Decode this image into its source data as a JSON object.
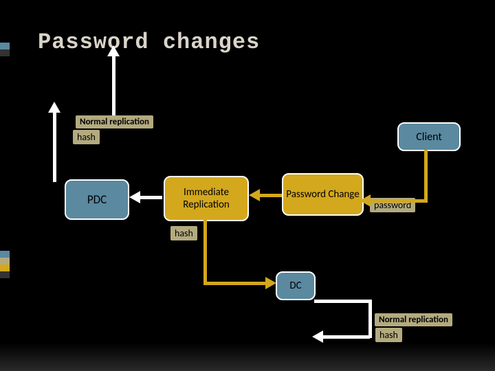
{
  "title": "Password changes",
  "boxes": {
    "pdc": "PDC",
    "immediate": "Immediate Replication",
    "pwchange": "Password Change",
    "client": "Client",
    "dc": "DC"
  },
  "labels": {
    "normal_replication_top": "Normal replication",
    "hash_top": "hash",
    "hash_mid": "hash",
    "password": "password",
    "normal_replication_bottom": "Normal replication",
    "hash_bottom": "hash"
  },
  "chart_data": {
    "type": "diagram",
    "title": "Password changes",
    "nodes": [
      {
        "id": "client",
        "label": "Client",
        "color": "blue"
      },
      {
        "id": "pwchange",
        "label": "Password Change",
        "color": "yellow"
      },
      {
        "id": "immediate",
        "label": "Immediate Replication",
        "color": "yellow"
      },
      {
        "id": "pdc",
        "label": "PDC",
        "color": "blue"
      },
      {
        "id": "dc",
        "label": "DC",
        "color": "blue"
      }
    ],
    "edges": [
      {
        "from": "client",
        "to": "pwchange",
        "label": "password"
      },
      {
        "from": "pwchange",
        "to": "immediate"
      },
      {
        "from": "immediate",
        "to": "pdc"
      },
      {
        "from": "pdc",
        "to": "others",
        "label": "Normal replication / hash"
      },
      {
        "from": "immediate",
        "to": "dc",
        "label": "hash"
      },
      {
        "from": "dc",
        "to": "others",
        "label": "Normal replication / hash"
      }
    ]
  }
}
